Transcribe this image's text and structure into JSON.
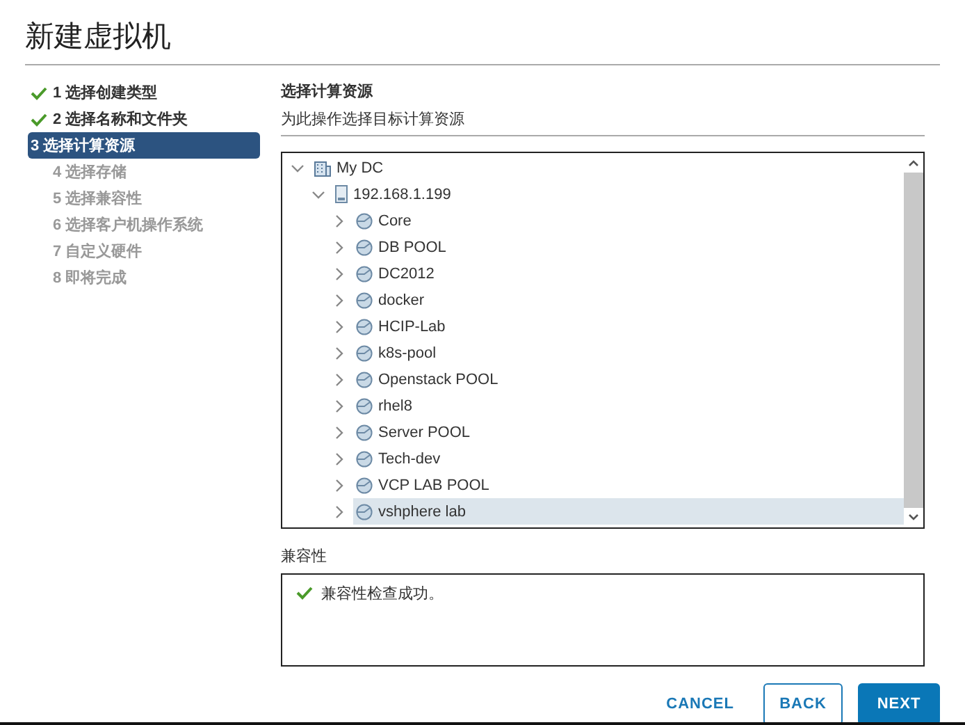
{
  "window": {
    "title": "新建虚拟机"
  },
  "steps": [
    {
      "label": "1 选择创建类型",
      "completed": true,
      "selected": false
    },
    {
      "label": "2 选择名称和文件夹",
      "completed": true,
      "selected": false
    },
    {
      "label": "3 选择计算资源",
      "completed": false,
      "selected": true
    },
    {
      "label": "4 选择存储",
      "completed": false,
      "selected": false
    },
    {
      "label": "5 选择兼容性",
      "completed": false,
      "selected": false
    },
    {
      "label": "6 选择客户机操作系统",
      "completed": false,
      "selected": false
    },
    {
      "label": "7 自定义硬件",
      "completed": false,
      "selected": false
    },
    {
      "label": "8 即将完成",
      "completed": false,
      "selected": false
    }
  ],
  "section": {
    "title": "选择计算资源",
    "subtitle": "为此操作选择目标计算资源"
  },
  "tree": [
    {
      "label": "My DC",
      "kind": "datacenter",
      "expanded": true,
      "selected": false,
      "children": [
        {
          "label": "192.168.1.199",
          "kind": "host",
          "expanded": true,
          "selected": false,
          "children": [
            {
              "label": "Core",
              "kind": "pool",
              "expanded": false,
              "selected": false
            },
            {
              "label": "DB POOL",
              "kind": "pool",
              "expanded": false,
              "selected": false
            },
            {
              "label": "DC2012",
              "kind": "pool",
              "expanded": false,
              "selected": false
            },
            {
              "label": "docker",
              "kind": "pool",
              "expanded": false,
              "selected": false
            },
            {
              "label": "HCIP-Lab",
              "kind": "pool",
              "expanded": false,
              "selected": false
            },
            {
              "label": "k8s-pool",
              "kind": "pool",
              "expanded": false,
              "selected": false
            },
            {
              "label": "Openstack POOL",
              "kind": "pool",
              "expanded": false,
              "selected": false
            },
            {
              "label": "rhel8",
              "kind": "pool",
              "expanded": false,
              "selected": false
            },
            {
              "label": "Server POOL",
              "kind": "pool",
              "expanded": false,
              "selected": false
            },
            {
              "label": "Tech-dev",
              "kind": "pool",
              "expanded": false,
              "selected": false
            },
            {
              "label": "VCP LAB POOL",
              "kind": "pool",
              "expanded": false,
              "selected": false
            },
            {
              "label": "vshphere lab",
              "kind": "pool",
              "expanded": false,
              "selected": true
            }
          ]
        }
      ]
    }
  ],
  "compatibility": {
    "label": "兼容性",
    "message": "兼容性检查成功。"
  },
  "buttons": [
    {
      "label": "CANCEL",
      "kind": "flat"
    },
    {
      "label": "BACK",
      "kind": "outline"
    },
    {
      "label": "NEXT",
      "kind": "primary"
    }
  ]
}
